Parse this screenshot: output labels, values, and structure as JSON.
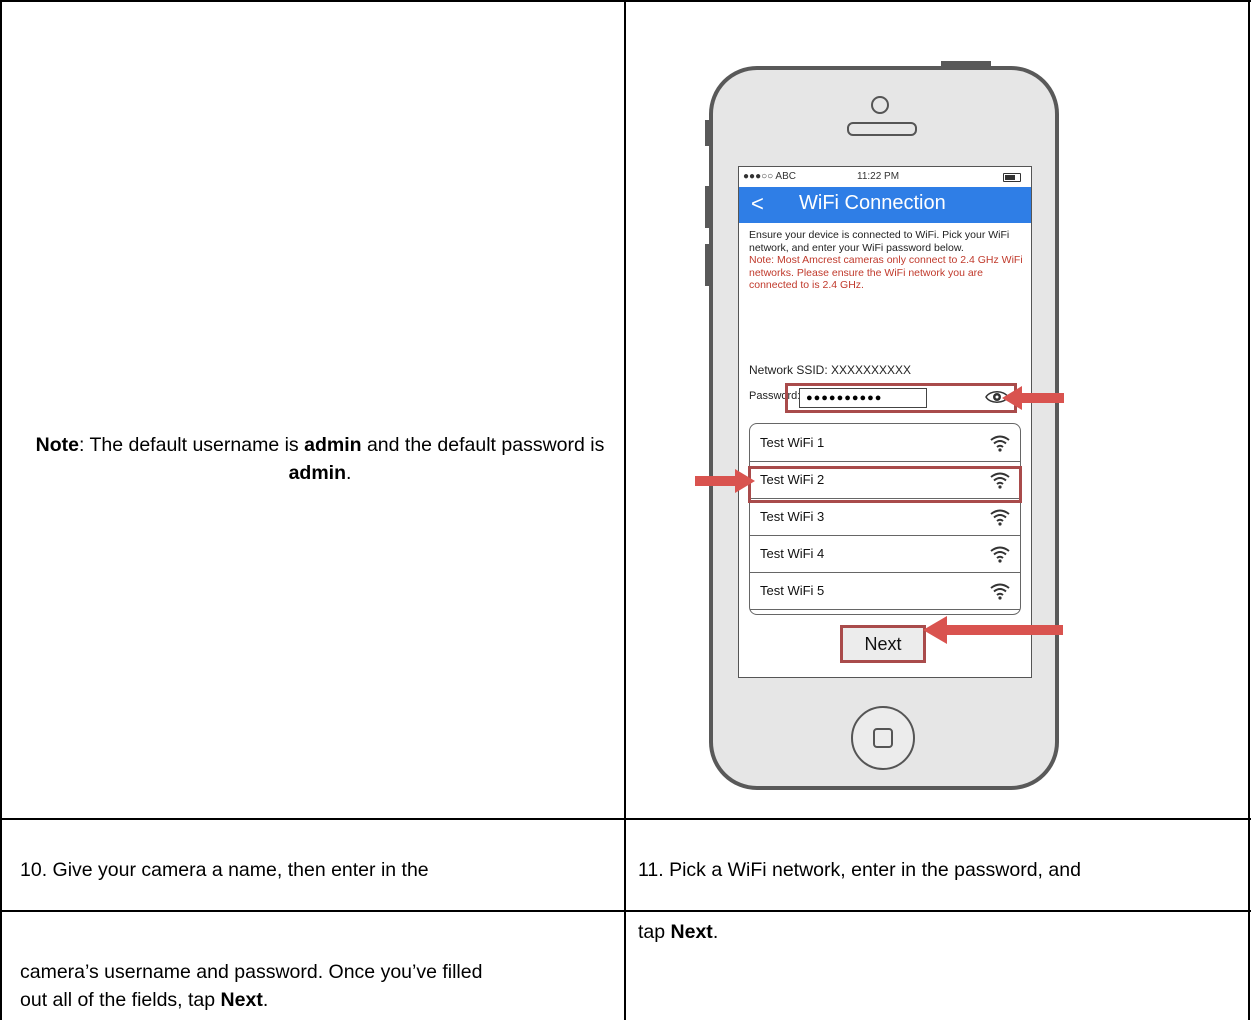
{
  "note": {
    "label": "Note",
    "text_1": ": The default username is ",
    "username": "admin",
    "text_2": " and the default password is ",
    "password": "admin",
    "text_3": "."
  },
  "step10": {
    "line1": "10. Give your camera a name, then enter in the",
    "line2a": "camera’s username and password. Once you’ve filled",
    "line2b": "out all of the fields, tap ",
    "next": "Next",
    "end": "."
  },
  "step11": {
    "line1": "11. Pick a WiFi network, enter in the password, and",
    "line2a": "tap ",
    "next": "Next",
    "end": "."
  },
  "phone": {
    "status": {
      "carrier": "●●●○○ ABC",
      "time": "11:22 PM"
    },
    "header": {
      "back": "<",
      "title": "WiFi Connection"
    },
    "description": "Ensure your device is connected to WiFi. Pick your WiFi network, and enter your WiFi password below.",
    "warning": "Note: Most Amcrest cameras only connect to 2.4 GHz WiFi networks. Please ensure the WiFi network you are connected to is 2.4 GHz.",
    "ssid_label": "Network SSID: XXXXXXXXXX",
    "password_label": "Password:",
    "password_value": "●●●●●●●●●●",
    "networks": [
      "Test WiFi 1",
      "Test WiFi 2",
      "Test WiFi 3",
      "Test WiFi 4",
      "Test WiFi 5"
    ],
    "next_label": "Next",
    "accent": "#2f7ee6",
    "highlight": "#a94b4b",
    "arrow_color": "#d9534f"
  }
}
